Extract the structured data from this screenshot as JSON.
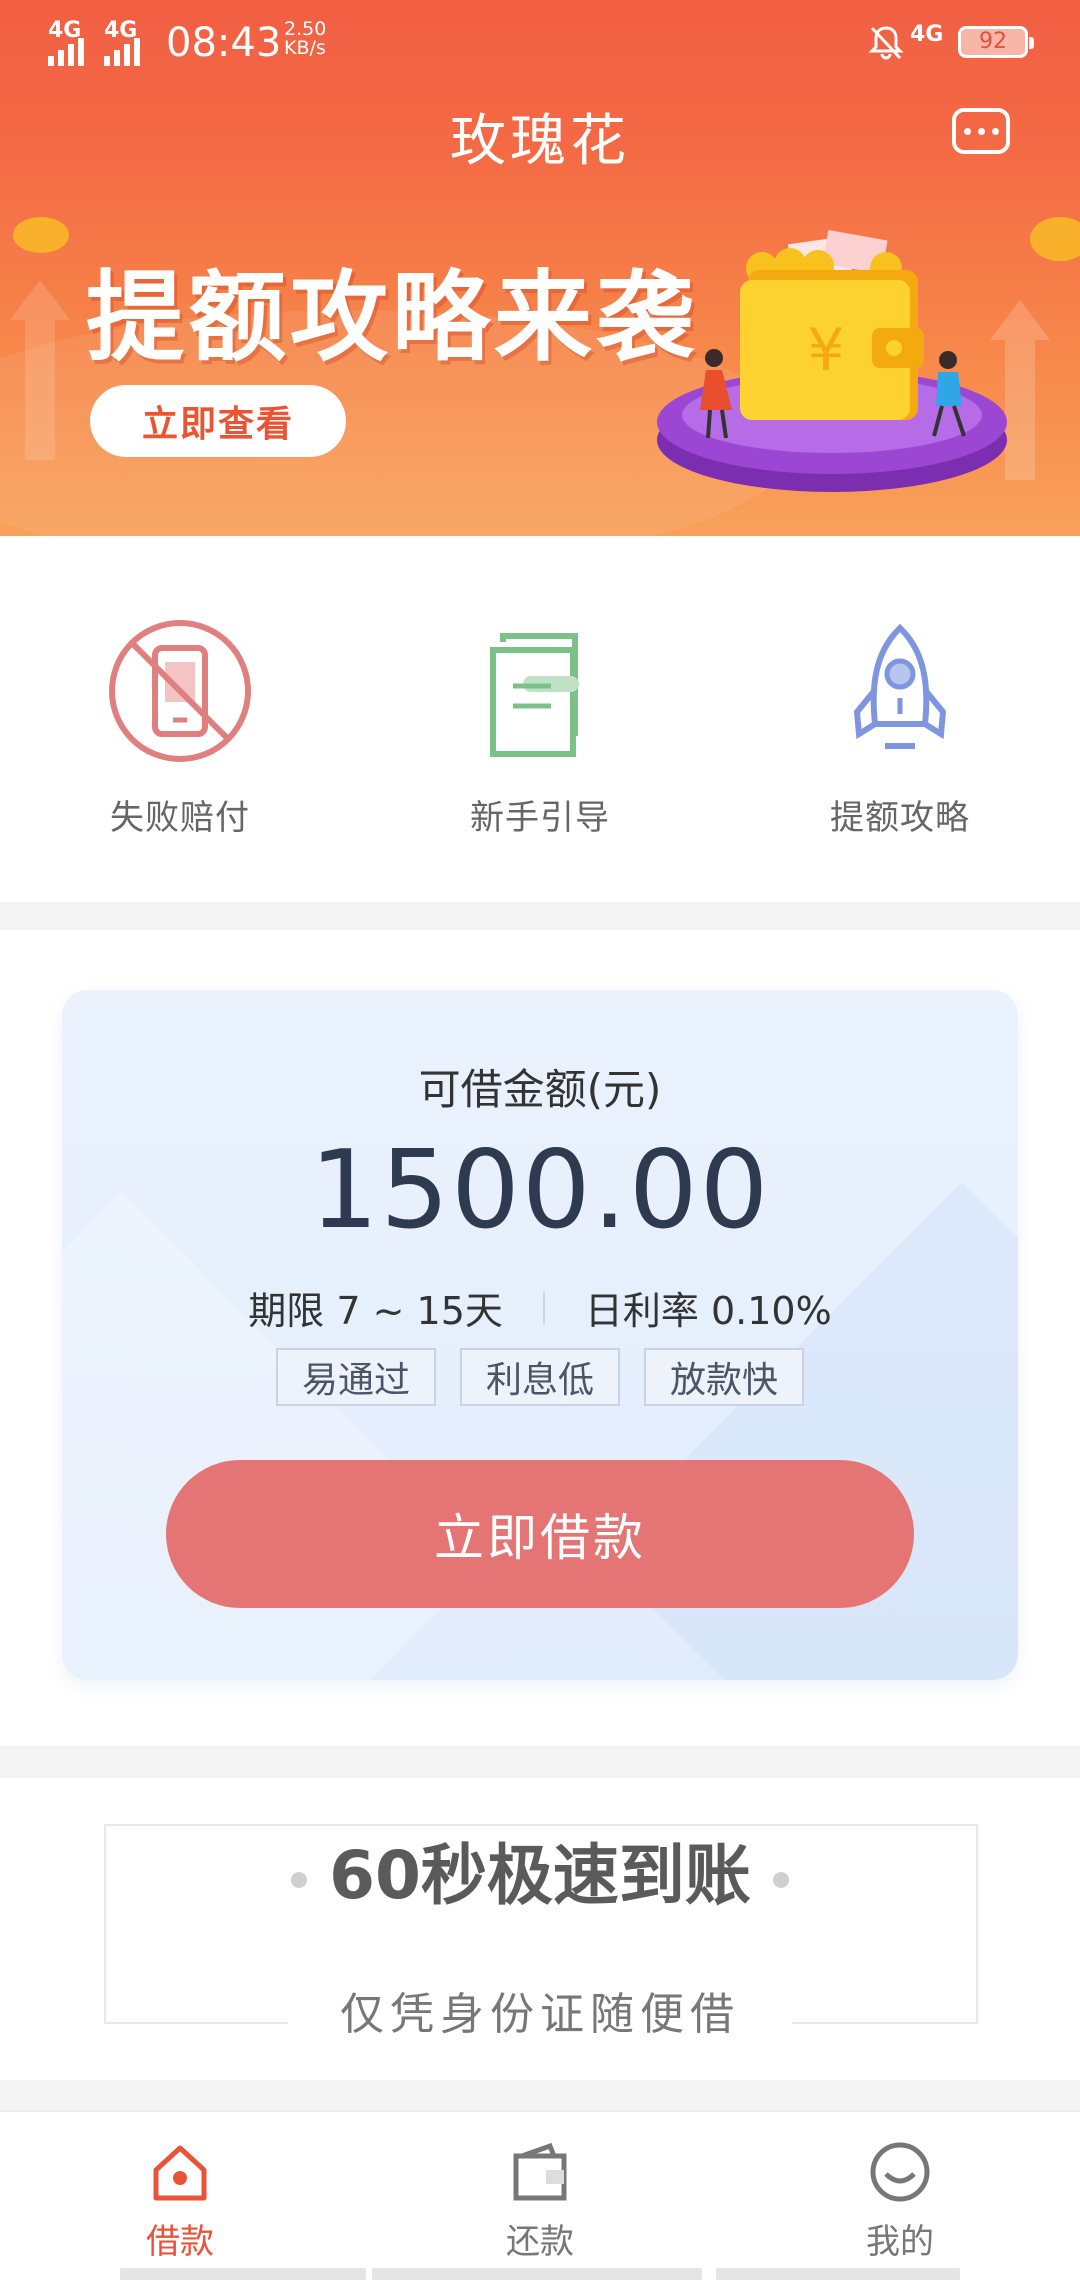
{
  "status_bar": {
    "network_left_1": "4G",
    "network_left_2": "4G",
    "time": "08:43",
    "speed_value": "2.50",
    "speed_unit": "KB/s",
    "network_right": "4G",
    "battery": "92"
  },
  "header": {
    "title": "玫瑰花",
    "message_icon": "chat-bubble-icon"
  },
  "banner": {
    "headline": "提额攻略来袭",
    "cta_label": "立即查看",
    "currency_symbol": "¥"
  },
  "quick_actions": [
    {
      "label": "失败赔付",
      "icon": "no-phone-icon",
      "color": "#e07f7f"
    },
    {
      "label": "新手引导",
      "icon": "guide-document-icon",
      "color": "#7cc08a"
    },
    {
      "label": "提额攻略",
      "icon": "rocket-icon",
      "color": "#7f95e0"
    }
  ],
  "loan_card": {
    "label": "可借金额(元)",
    "amount": "1500.00",
    "term": "期限 7 ~ 15天",
    "daily_rate": "日利率 0.10%",
    "tags": [
      "易通过",
      "利息低",
      "放款快"
    ],
    "button_label": "立即借款",
    "button_color": "#e57575"
  },
  "promo": {
    "title": "60秒极速到账",
    "subtitle": "仅凭身份证随便借"
  },
  "tabbar": {
    "items": [
      {
        "label": "借款",
        "icon": "home-icon",
        "active": true
      },
      {
        "label": "还款",
        "icon": "wallet-icon",
        "active": false
      },
      {
        "label": "我的",
        "icon": "profile-icon",
        "active": false
      }
    ],
    "active_color": "#e8533a"
  }
}
